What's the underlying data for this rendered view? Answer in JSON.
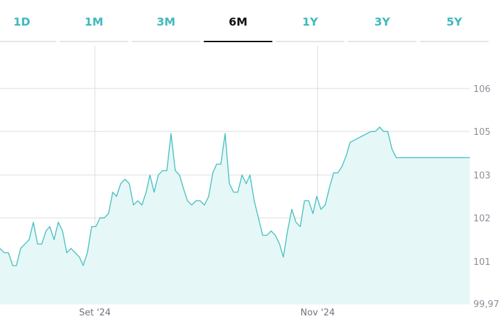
{
  "tabs": [
    {
      "label": "1D",
      "active": false
    },
    {
      "label": "1M",
      "active": false
    },
    {
      "label": "3M",
      "active": false
    },
    {
      "label": "6M",
      "active": true
    },
    {
      "label": "1Y",
      "active": false
    },
    {
      "label": "3Y",
      "active": false
    },
    {
      "label": "5Y",
      "active": false
    }
  ],
  "colors": {
    "accent": "#3fb8bd",
    "line": "#4cc2c2",
    "fill": "#e6f7f7",
    "grid": "#dddddd",
    "tab_active": "#111111"
  },
  "chart_data": {
    "type": "area",
    "title": "",
    "xlabel": "",
    "ylabel": "",
    "ylim": [
      99.97,
      106.8
    ],
    "xlim": [
      0,
      100
    ],
    "grid": true,
    "y_ticks": [
      {
        "value": 106,
        "label": "106"
      },
      {
        "value": 105,
        "label": "105"
      },
      {
        "value": 103,
        "label": "103"
      },
      {
        "value": 102,
        "label": "102"
      },
      {
        "value": 101,
        "label": "101"
      },
      {
        "value": 99.97,
        "label": "99,97"
      }
    ],
    "x_ticks": [
      {
        "value": 20.2,
        "label": "Set '24"
      },
      {
        "value": 67.6,
        "label": "Nov '24"
      }
    ],
    "series": [
      {
        "x": [
          0,
          0.9,
          1.8,
          2.7,
          3.5,
          4.4,
          5.3,
          6.2,
          7.1,
          8.0,
          8.9,
          9.8,
          10.6,
          11.5,
          12.4,
          13.3,
          14.2,
          15.1,
          16.0,
          16.9,
          17.7,
          18.6,
          19.5,
          20.4,
          21.3,
          22.2,
          23.1,
          24.0,
          24.8,
          25.7,
          26.6,
          27.5,
          28.4,
          29.3,
          30.2,
          31.1,
          31.9,
          32.8,
          33.7,
          34.6,
          35.5,
          36.4,
          37.3,
          38.2,
          39.0,
          39.9,
          40.8,
          41.7,
          42.6,
          43.5,
          44.4,
          45.3,
          46.1,
          47.0,
          47.9,
          48.8,
          49.7,
          50.6,
          51.5,
          52.4,
          53.2,
          54.1,
          55.0,
          55.9,
          56.8,
          57.7,
          58.6,
          59.5,
          60.3,
          61.2,
          62.1,
          63.0,
          63.9,
          64.8,
          65.7,
          66.6,
          67.4,
          68.3,
          69.2,
          70.1,
          71.0,
          71.9,
          72.8,
          73.7,
          74.5,
          75.4,
          76.3,
          77.2,
          78.1,
          79.0,
          79.9,
          80.8,
          81.6,
          82.5,
          83.4,
          84.3,
          85.2,
          86.1,
          87.0,
          87.9,
          88.7,
          89.6,
          90.5,
          91.4,
          92.3,
          93.2,
          94.1,
          95.0,
          95.8,
          96.7,
          97.6,
          98.5,
          99.4,
          100
        ],
        "values": [
          101.3,
          101.2,
          101.2,
          100.9,
          100.9,
          101.3,
          101.4,
          101.5,
          101.9,
          101.4,
          101.4,
          101.7,
          101.8,
          101.5,
          101.9,
          101.7,
          101.2,
          101.3,
          101.2,
          101.1,
          100.9,
          101.2,
          101.8,
          101.8,
          102.0,
          102.0,
          102.1,
          102.6,
          102.5,
          102.8,
          102.9,
          102.8,
          102.3,
          102.4,
          102.3,
          102.6,
          103.0,
          102.6,
          103.0,
          103.2,
          103.2,
          104.9,
          103.2,
          103.0,
          102.7,
          102.4,
          102.3,
          102.4,
          102.4,
          102.3,
          102.5,
          103.1,
          103.5,
          103.5,
          104.9,
          102.8,
          102.6,
          102.6,
          103.0,
          102.8,
          103.0,
          102.4,
          102.0,
          101.6,
          101.6,
          101.7,
          101.6,
          101.4,
          101.1,
          101.7,
          102.2,
          101.9,
          101.8,
          102.4,
          102.4,
          102.1,
          102.5,
          102.2,
          102.3,
          102.7,
          103.1,
          103.1,
          103.4,
          103.9,
          104.5,
          104.6,
          104.7,
          104.8,
          104.9,
          105.0,
          105.0,
          105.1,
          105.0,
          105.0,
          104.2,
          103.8,
          103.8,
          103.8,
          103.8,
          103.8,
          103.8,
          103.8,
          103.8,
          103.8,
          103.8,
          103.8,
          103.8,
          103.8,
          103.8,
          103.8,
          103.8,
          103.8,
          103.8,
          103.8
        ]
      }
    ]
  }
}
